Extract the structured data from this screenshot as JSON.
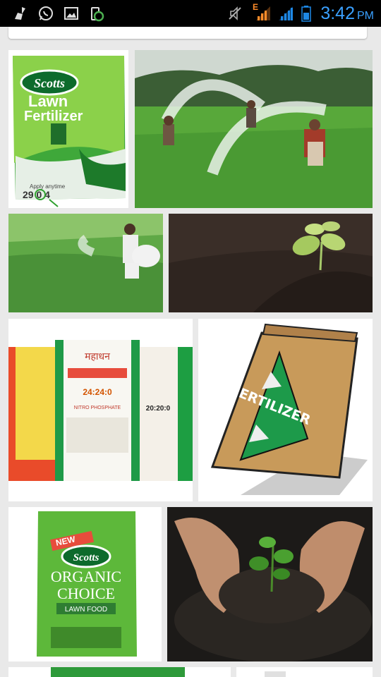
{
  "status_bar": {
    "time": "3:42",
    "ampm": "PM",
    "network_letter": "E",
    "icons": [
      "broom-icon",
      "whatsapp-icon",
      "gallery-icon",
      "clean-master-icon",
      "mute-icon",
      "signal-icon",
      "signal-icon-2",
      "battery-icon"
    ]
  },
  "images": [
    {
      "name": "scotts-lawn-fertilizer-bag",
      "brand": "Scotts",
      "line1": "Lawn",
      "line2": "Fertilizer",
      "npk": "29 0 4",
      "small": "Apply anytime"
    },
    {
      "name": "farmers-spraying-field"
    },
    {
      "name": "woman-broadcasting-fertilizer"
    },
    {
      "name": "seedling-in-soil"
    },
    {
      "name": "mahadhan-fertilizer-bags",
      "brand": "महाधन",
      "label1": "24:24:0",
      "label2": "20:20:0",
      "label3": "NITRO PHOSPHATE"
    },
    {
      "name": "fertilizer-bag-illustration",
      "label": "FERTILIZER"
    },
    {
      "name": "scotts-organic-choice-bag",
      "badge": "NEW",
      "brand": "Scotts",
      "line1": "ORGANIC",
      "line2": "CHOICE",
      "line3": "LAWN FOOD"
    },
    {
      "name": "hands-holding-seedling"
    },
    {
      "name": "partial-green-image"
    },
    {
      "name": "partial-white-image"
    }
  ]
}
